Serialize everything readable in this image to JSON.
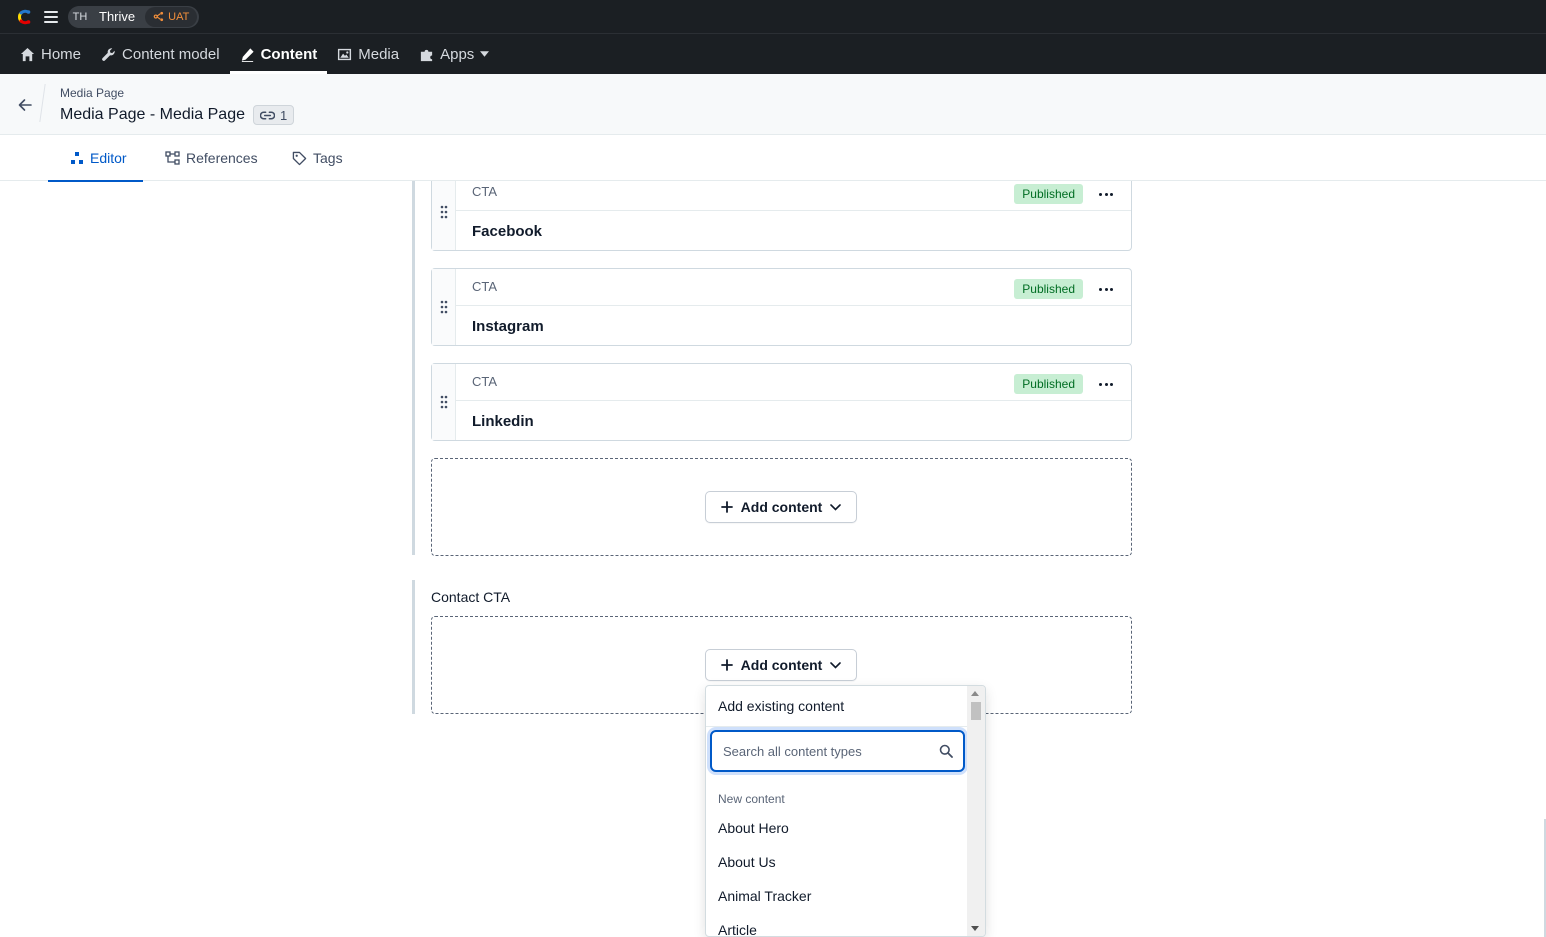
{
  "topbar": {
    "space_initials": "TH",
    "space_name": "Thrive",
    "environment": "UAT"
  },
  "nav": {
    "items": [
      {
        "label": "Home",
        "icon": "home-icon"
      },
      {
        "label": "Content model",
        "icon": "wrench-icon"
      },
      {
        "label": "Content",
        "icon": "edit-icon",
        "active": true
      },
      {
        "label": "Media",
        "icon": "image-icon"
      },
      {
        "label": "Apps",
        "icon": "puzzle-icon",
        "has_dropdown": true
      }
    ]
  },
  "entry": {
    "breadcrumb": "Media Page",
    "title": "Media Page - Media Page",
    "reference_count": "1"
  },
  "tabs": [
    {
      "label": "Editor",
      "active": true
    },
    {
      "label": "References"
    },
    {
      "label": "Tags"
    }
  ],
  "references": [
    {
      "type": "CTA",
      "name": "Facebook",
      "status": "Published"
    },
    {
      "type": "CTA",
      "name": "Instagram",
      "status": "Published"
    },
    {
      "type": "CTA",
      "name": "Linkedin",
      "status": "Published"
    }
  ],
  "add_content_label": "Add content",
  "contact_field_label": "Contact CTA",
  "dropdown": {
    "existing_label": "Add existing content",
    "search_placeholder": "Search all content types",
    "group_label": "New content",
    "items": [
      "About Hero",
      "About Us",
      "Animal Tracker",
      "Article"
    ]
  },
  "colors": {
    "nav_bg": "#1b1f23",
    "accent": "#0059c8",
    "published_bg": "#c7eed3",
    "published_text": "#006d23",
    "env_orange": "#f28f3b"
  }
}
